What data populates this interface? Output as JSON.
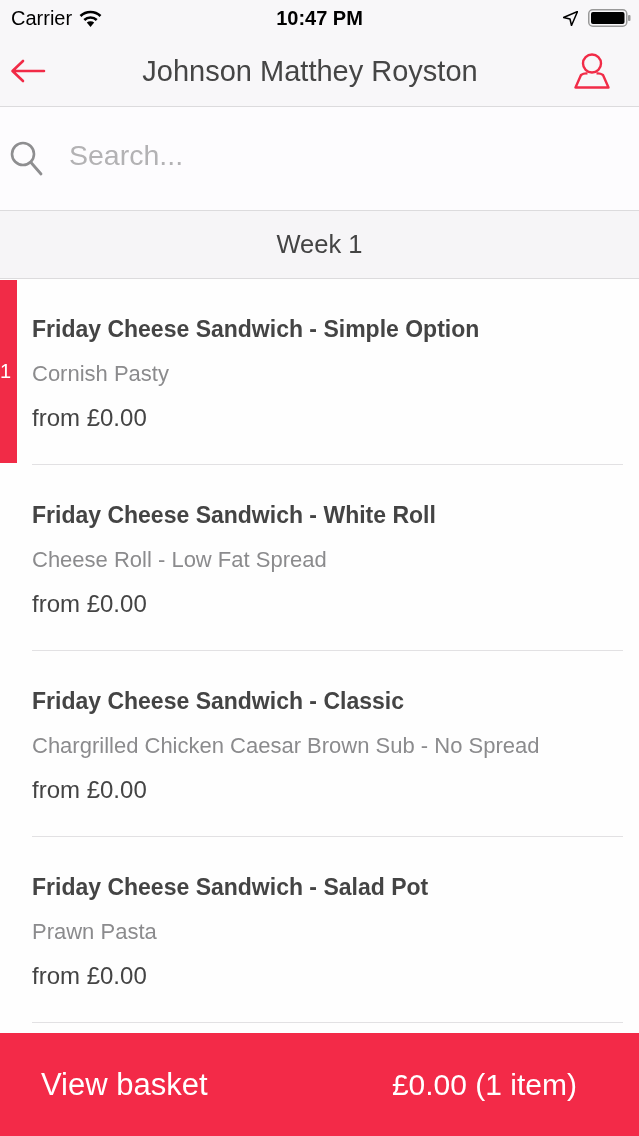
{
  "status_bar": {
    "carrier": "Carrier",
    "time": "10:47 PM"
  },
  "nav_bar": {
    "title": "Johnson Matthey Royston"
  },
  "search": {
    "placeholder": "Search..."
  },
  "section": {
    "title": "Week 1"
  },
  "items": [
    {
      "name": "Friday Cheese Sandwich - Simple Option",
      "description": "Cornish Pasty",
      "price": "from £0.00",
      "count": "1"
    },
    {
      "name": "Friday Cheese Sandwich - White Roll",
      "description": "Cheese Roll - Low Fat Spread",
      "price": "from £0.00"
    },
    {
      "name": "Friday Cheese Sandwich - Classic",
      "description": "Chargrilled Chicken Caesar Brown Sub - No Spread",
      "price": "from £0.00"
    },
    {
      "name": "Friday Cheese Sandwich - Salad Pot",
      "description": "Prawn Pasta",
      "price": "from £0.00"
    }
  ],
  "basket": {
    "label": "View basket",
    "summary": "£0.00 (1 item)"
  }
}
